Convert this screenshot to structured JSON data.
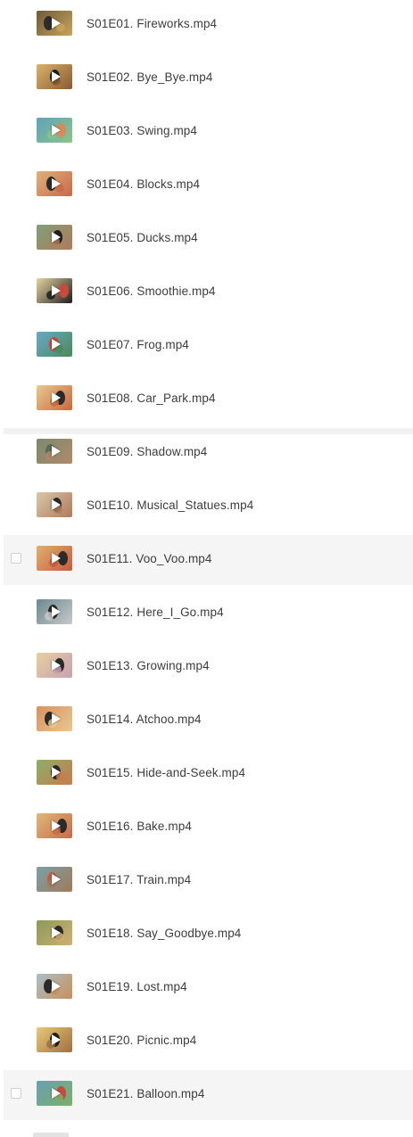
{
  "files": [
    {
      "name": "S01E01. Fireworks.mp4",
      "thumb": [
        "#6d5a3a",
        "#c9a35a",
        "#2b2b2b"
      ],
      "checkbox": false,
      "hovered": false
    },
    {
      "name": "S01E02. Bye_Bye.mp4",
      "thumb": [
        "#d9b36a",
        "#8a5a32",
        "#1f1f1f"
      ],
      "checkbox": false,
      "hovered": false
    },
    {
      "name": "S01E03. Swing.mp4",
      "thumb": [
        "#5fa3b8",
        "#8bc48a",
        "#d98a5a"
      ],
      "checkbox": false,
      "hovered": false
    },
    {
      "name": "S01E04. Blocks.mp4",
      "thumb": [
        "#e0b078",
        "#c86a4a",
        "#2a2a2a"
      ],
      "checkbox": false,
      "hovered": false
    },
    {
      "name": "S01E05. Ducks.mp4",
      "thumb": [
        "#7fa07a",
        "#b07a5a",
        "#1f1f1f"
      ],
      "checkbox": false,
      "hovered": false
    },
    {
      "name": "S01E06. Smoothie.mp4",
      "thumb": [
        "#e6d4a0",
        "#1f1f1f",
        "#c84a3a"
      ],
      "checkbox": false,
      "hovered": false
    },
    {
      "name": "S01E07. Frog.mp4",
      "thumb": [
        "#6aa8c8",
        "#4a8a5a",
        "#c84a3a"
      ],
      "checkbox": false,
      "hovered": false
    },
    {
      "name": "S01E08. Car_Park.mp4",
      "thumb": [
        "#e8c890",
        "#c86a3a",
        "#2a2a2a"
      ],
      "checkbox": false,
      "hovered": false
    },
    {
      "name": "S01E09. Shadow.mp4",
      "thumb": [
        "#7a8a70",
        "#b08a6a",
        "#5a6a5a"
      ],
      "checkbox": false,
      "hovered": false
    },
    {
      "name": "S01E10. Musical_Statues.mp4",
      "thumb": [
        "#d8c8a8",
        "#b07a5a",
        "#2a2a2a"
      ],
      "checkbox": false,
      "hovered": false
    },
    {
      "name": "S01E11. Voo_Voo.mp4",
      "thumb": [
        "#e0b070",
        "#c85a3a",
        "#2a2a2a"
      ],
      "checkbox": true,
      "hovered": true
    },
    {
      "name": "S01E12. Here_I_Go.mp4",
      "thumb": [
        "#6a8a90",
        "#c8c8c8",
        "#2a2a2a"
      ],
      "checkbox": false,
      "hovered": false
    },
    {
      "name": "S01E13. Growing.mp4",
      "thumb": [
        "#e8d0a0",
        "#c8a0b0",
        "#2a2a2a"
      ],
      "checkbox": false,
      "hovered": false
    },
    {
      "name": "S01E14. Atchoo.mp4",
      "thumb": [
        "#d89060",
        "#e8c890",
        "#2a2a2a"
      ],
      "checkbox": false,
      "hovered": false
    },
    {
      "name": "S01E15. Hide-and-Seek.mp4",
      "thumb": [
        "#8ab06a",
        "#c87a4a",
        "#2a2a2a"
      ],
      "checkbox": false,
      "hovered": false
    },
    {
      "name": "S01E16. Bake.mp4",
      "thumb": [
        "#e0b878",
        "#c86a4a",
        "#2a2a2a"
      ],
      "checkbox": false,
      "hovered": false
    },
    {
      "name": "S01E17. Train.mp4",
      "thumb": [
        "#7aa0a8",
        "#a07a5a",
        "#c85a4a"
      ],
      "checkbox": false,
      "hovered": false
    },
    {
      "name": "S01E18. Say_Goodbye.mp4",
      "thumb": [
        "#8a9a5a",
        "#d0b070",
        "#2a2a2a"
      ],
      "checkbox": false,
      "hovered": false
    },
    {
      "name": "S01E19. Lost.mp4",
      "thumb": [
        "#a8c0c8",
        "#c8905a",
        "#2a2a2a"
      ],
      "checkbox": false,
      "hovered": false
    },
    {
      "name": "S01E20. Picnic.mp4",
      "thumb": [
        "#e8c878",
        "#a07040",
        "#1f1f1f"
      ],
      "checkbox": false,
      "hovered": false
    },
    {
      "name": "S01E21. Balloon.mp4",
      "thumb": [
        "#6aa0b0",
        "#7ab06a",
        "#c84a3a"
      ],
      "checkbox": true,
      "hovered": true
    }
  ]
}
